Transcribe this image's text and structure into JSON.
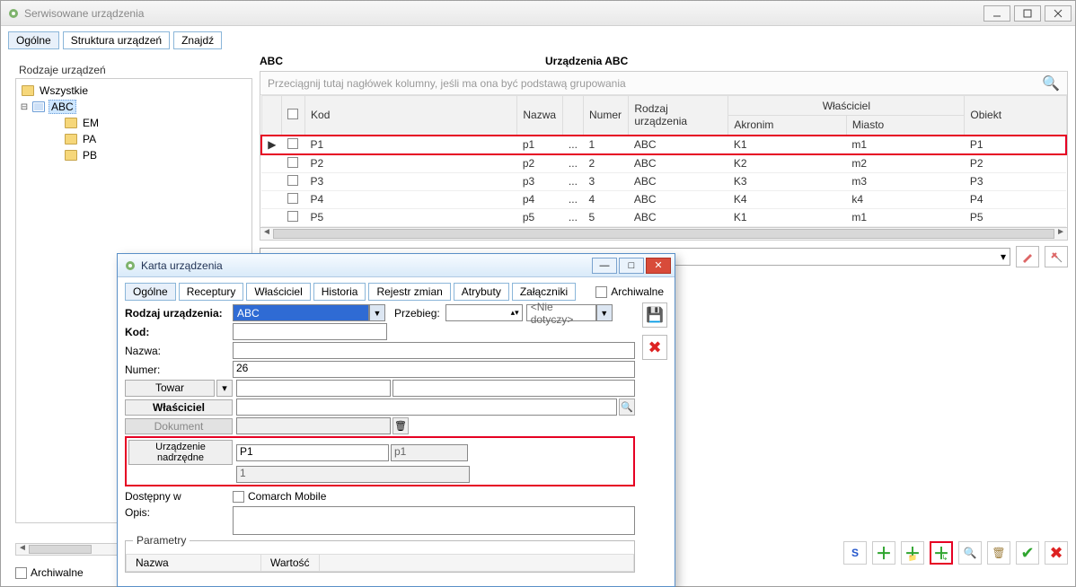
{
  "main_window": {
    "title": "Serwisowane urządzenia"
  },
  "tabs_main": {
    "ogolne": "Ogólne",
    "struktura": "Struktura urządzeń",
    "znajdz": "Znajdź"
  },
  "left": {
    "title": "Rodzaje urządzeń",
    "root": "Wszystkie",
    "abc": "ABC",
    "em": "EM",
    "pa": "PA",
    "pb": "PB",
    "archiwalne": "Archiwalne"
  },
  "heading": {
    "left": "ABC",
    "right": "Urządzenia ABC"
  },
  "groupby_hint": "Przeciągnij tutaj nagłówek kolumny, jeśli ma ona być podstawą grupowania",
  "columns": {
    "kod": "Kod",
    "nazwa": "Nazwa",
    "numer": "Numer",
    "rodzaj": "Rodzaj urządzenia",
    "owner": "Właściciel",
    "akronim": "Akronim",
    "miasto": "Miasto",
    "obiekt": "Obiekt"
  },
  "rows": [
    {
      "kod": "P1",
      "nazwa": "p1",
      "numer": "1",
      "rodzaj": "ABC",
      "akronim": "K1",
      "miasto": "m1",
      "obiekt": "P1"
    },
    {
      "kod": "P2",
      "nazwa": "p2",
      "numer": "2",
      "rodzaj": "ABC",
      "akronim": "K2",
      "miasto": "m2",
      "obiekt": "P2"
    },
    {
      "kod": "P3",
      "nazwa": "p3",
      "numer": "3",
      "rodzaj": "ABC",
      "akronim": "K3",
      "miasto": "m3",
      "obiekt": "P3"
    },
    {
      "kod": "P4",
      "nazwa": "p4",
      "numer": "4",
      "rodzaj": "ABC",
      "akronim": "K4",
      "miasto": "k4",
      "obiekt": "P4"
    },
    {
      "kod": "P5",
      "nazwa": "p5",
      "numer": "5",
      "rodzaj": "ABC",
      "akronim": "K1",
      "miasto": "m1",
      "obiekt": "P5"
    }
  ],
  "dialog": {
    "title": "Karta urządzenia",
    "tabs": {
      "ogolne": "Ogólne",
      "receptury": "Receptury",
      "wlasciciel": "Właściciel",
      "historia": "Historia",
      "rejestr": "Rejestr zmian",
      "atrybuty": "Atrybuty",
      "zalaczniki": "Załączniki"
    },
    "archiwalne": "Archiwalne",
    "labels": {
      "rodzaj": "Rodzaj urządzenia:",
      "kod": "Kod:",
      "nazwa": "Nazwa:",
      "numer": "Numer:",
      "towar": "Towar",
      "wlasciciel": "Właściciel",
      "dokument": "Dokument",
      "urz_nadrz": "Urządzenie nadrzędne",
      "dostepny": "Dostępny w",
      "comarch": "Comarch Mobile",
      "opis": "Opis:",
      "param": "Parametry",
      "param_nazwa": "Nazwa",
      "param_wartosc": "Wartość",
      "przebieg": "Przebieg:",
      "nie_dotyczy": "<Nie dotyczy>"
    },
    "values": {
      "rodzaj": "ABC",
      "numer": "26",
      "nadrz_kod": "P1",
      "nadrz_nazwa": "p1",
      "nadrz_numer": "1"
    }
  },
  "toolbar": {
    "s": "S"
  }
}
